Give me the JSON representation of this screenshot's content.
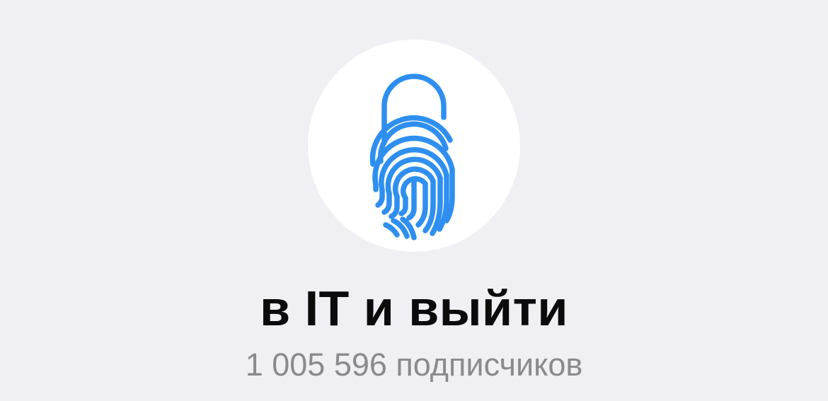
{
  "channel": {
    "title": "в IT и выйти",
    "subscribers": "1 005 596 подписчиков",
    "avatar_icon": "fingerprint-lock-icon",
    "accent_color": "#2e8ff0"
  }
}
